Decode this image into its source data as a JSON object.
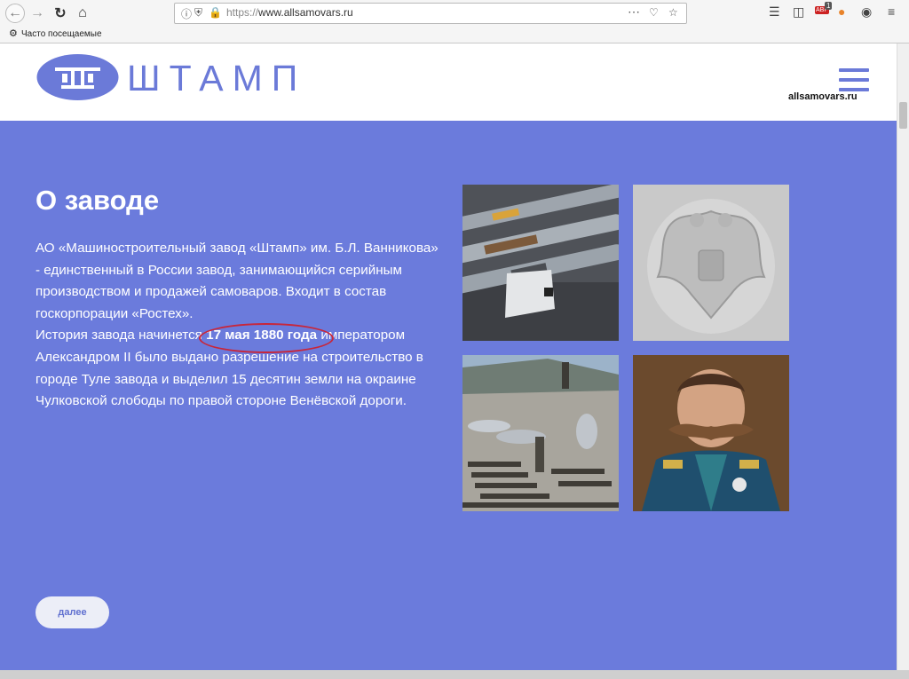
{
  "browser": {
    "url_protocol": "https://",
    "url_domain": "www.allsamovars.ru",
    "bookmark_label": "Часто посещаемые",
    "badge_count": "1",
    "abp_label": "ABP"
  },
  "header": {
    "brand": "ШТАМП",
    "domain": "allsamovars.ru"
  },
  "hero": {
    "title": "О заводе",
    "text_before": "АО «Машиностроительный завод «Штамп» им. Б.Л. Ванникова» - единственный в России завод, занимающийся серийным производством и продажей самоваров. Входит в состав госкорпорации «Ростех».",
    "text_history_start": "История завода начинется ",
    "highlight": "17 мая 1880 года",
    "text_history_end": " императором Александром II было выдано разрешение на строительство в городе Туле завода и выделил 15 десятин земли на окраине Чулковской слободы по правой стороне Венёвской дороги.",
    "more_button": "далее"
  },
  "colors": {
    "hero_bg": "#6b7bdc",
    "brand": "#6b7ad8",
    "highlight_ring": "#c8263a"
  },
  "icons": {
    "back": "back-arrow-icon",
    "forward": "forward-arrow-icon",
    "reload": "reload-icon",
    "home": "home-icon",
    "menu": "hamburger-menu-icon"
  }
}
